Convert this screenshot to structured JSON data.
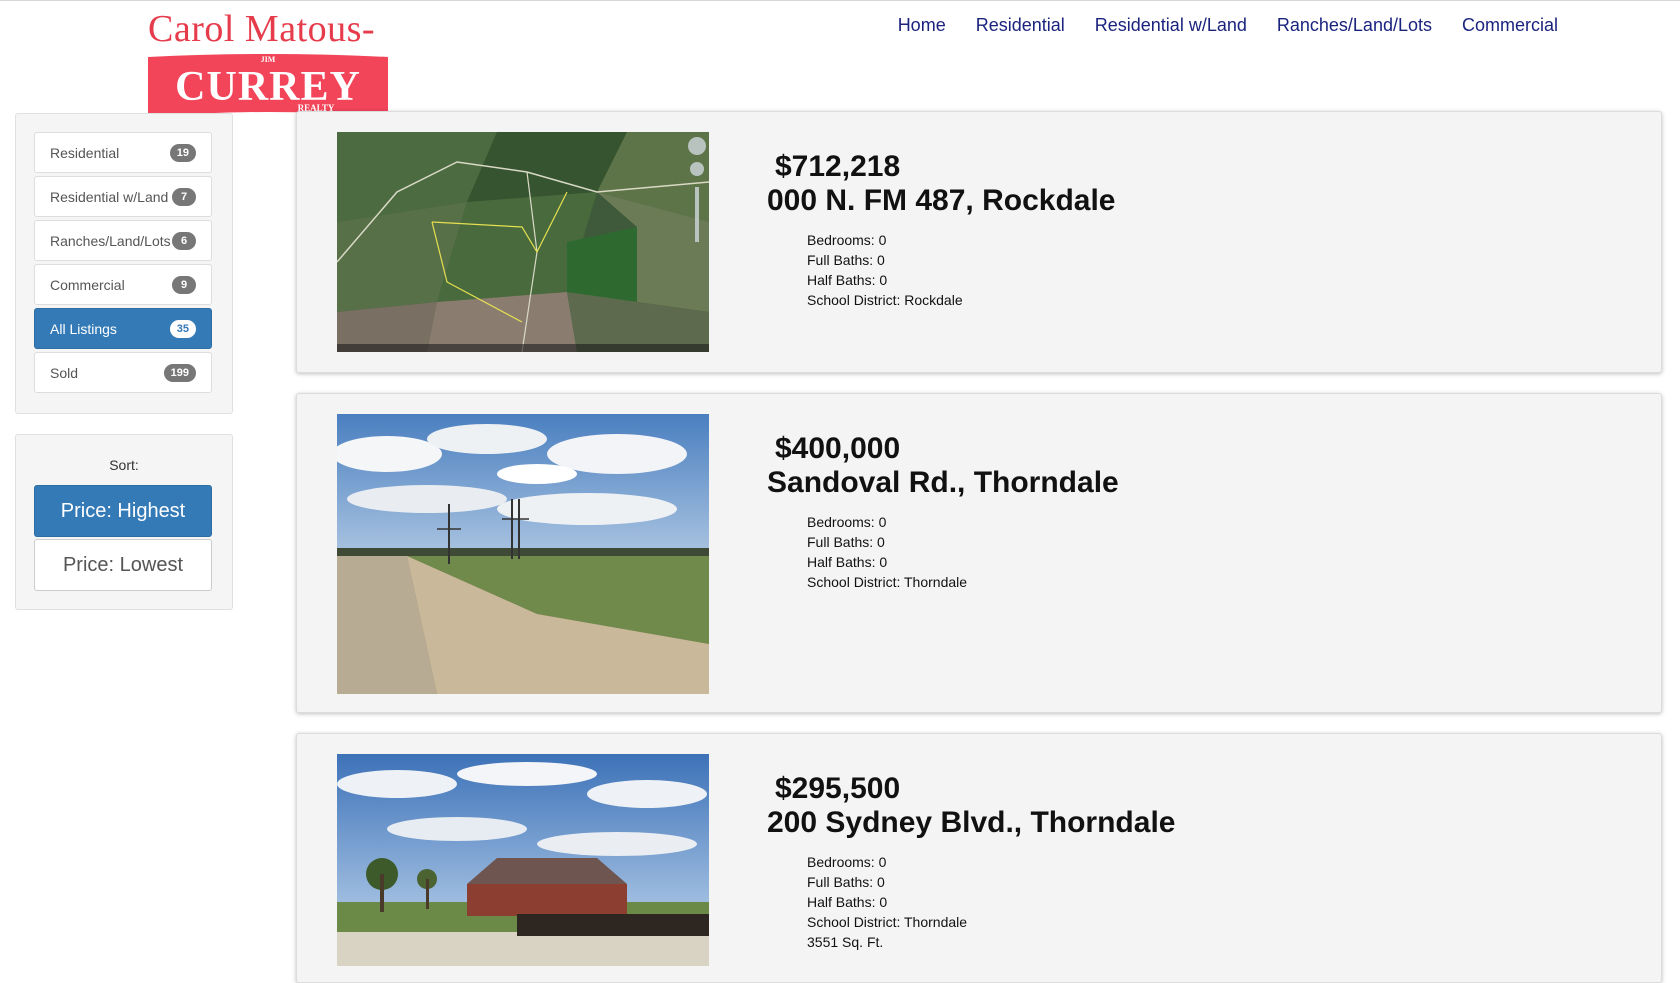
{
  "logo": {
    "top_text": "Carol Matous-",
    "small_text": "JIM",
    "main_text": "CURREY",
    "sub_text": "REALTY",
    "color": "#e63b4b"
  },
  "nav": {
    "items": [
      "Home",
      "Residential",
      "Residential w/Land",
      "Ranches/Land/Lots",
      "Commercial"
    ]
  },
  "sidebar": {
    "categories": [
      {
        "label": "Residential",
        "count": "19",
        "active": false
      },
      {
        "label": "Residential w/Land",
        "count": "7",
        "active": false
      },
      {
        "label": "Ranches/Land/Lots",
        "count": "6",
        "active": false
      },
      {
        "label": "Commercial",
        "count": "9",
        "active": false
      },
      {
        "label": "All Listings",
        "count": "35",
        "active": true
      },
      {
        "label": "Sold",
        "count": "199",
        "active": false
      }
    ],
    "sort": {
      "label": "Sort:",
      "options": [
        {
          "label": "Price: Highest",
          "active": true
        },
        {
          "label": "Price: Lowest",
          "active": false
        }
      ]
    }
  },
  "listings": [
    {
      "price": "$712,218",
      "address": "000 N. FM 487,  Rockdale",
      "details": [
        "Bedrooms: 0",
        "Full Baths: 0",
        "Half Baths: 0",
        "School District: Rockdale"
      ],
      "image": "aerial-satellite-map"
    },
    {
      "price": "$400,000",
      "address": "Sandoval Rd.,  Thorndale",
      "details": [
        "Bedrooms: 0",
        "Full Baths: 0",
        "Half Baths: 0",
        "School District: Thorndale"
      ],
      "image": "dirt-road-field-photo"
    },
    {
      "price": "$295,500",
      "address": "200 Sydney Blvd.,  Thorndale",
      "details": [
        "Bedrooms: 0",
        "Full Baths: 0",
        "Half Baths: 0",
        "School District: Thorndale",
        "3551 Sq. Ft."
      ],
      "image": "brick-house-photo"
    }
  ],
  "colors": {
    "accent": "#337ab7",
    "nav_link": "#1a237e",
    "badge": "#777777"
  }
}
